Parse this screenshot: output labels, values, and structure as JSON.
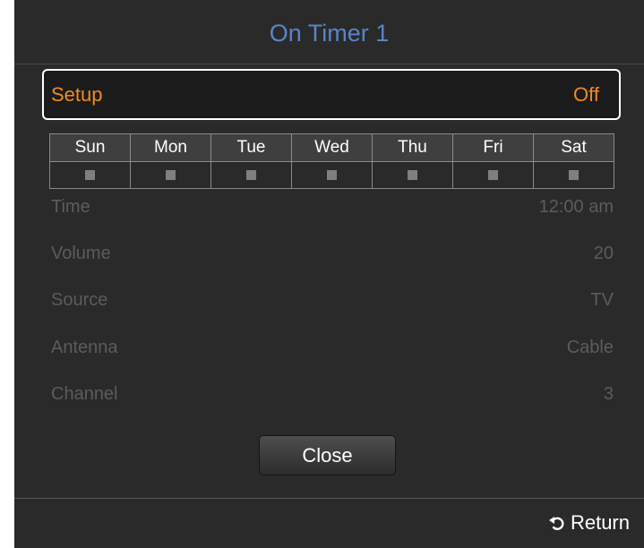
{
  "dialog": {
    "title": "On Timer 1"
  },
  "setup": {
    "label": "Setup",
    "value": "Off"
  },
  "days": [
    {
      "label": "Sun",
      "checked": false
    },
    {
      "label": "Mon",
      "checked": false
    },
    {
      "label": "Tue",
      "checked": false
    },
    {
      "label": "Wed",
      "checked": false
    },
    {
      "label": "Thu",
      "checked": false
    },
    {
      "label": "Fri",
      "checked": false
    },
    {
      "label": "Sat",
      "checked": false
    }
  ],
  "fields": [
    {
      "label": "Time",
      "value": "12:00 am"
    },
    {
      "label": "Volume",
      "value": "20"
    },
    {
      "label": "Source",
      "value": "TV"
    },
    {
      "label": "Antenna",
      "value": "Cable"
    },
    {
      "label": "Channel",
      "value": "3"
    }
  ],
  "close_label": "Close",
  "footer": {
    "return_label": "Return",
    "return_icon": "return-arrow-icon"
  },
  "colors": {
    "title": "#5a84c8",
    "highlight": "#f08a24",
    "disabled_text": "#5c5c5c",
    "background": "#2a2a2a"
  }
}
